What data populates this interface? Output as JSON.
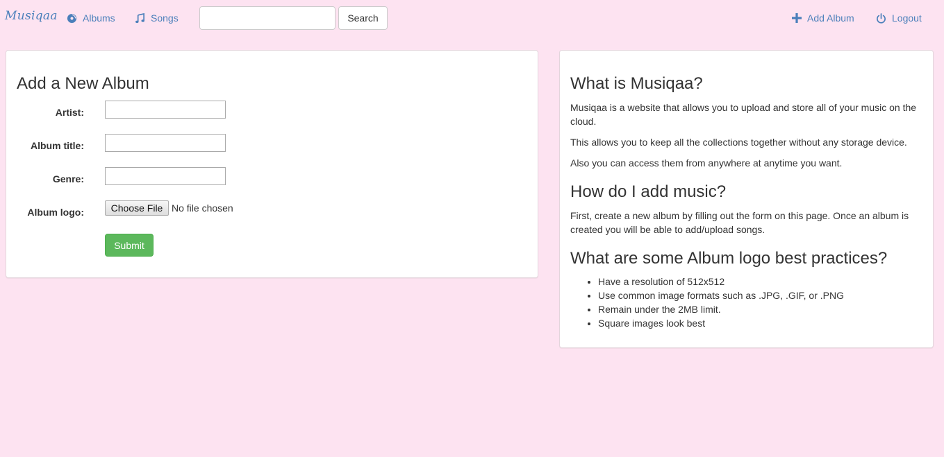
{
  "nav": {
    "brand": "Musiqaa",
    "albums_label": "Albums",
    "songs_label": "Songs",
    "search_placeholder": "",
    "search_button": "Search",
    "add_album_label": "Add Album",
    "logout_label": "Logout"
  },
  "form": {
    "title": "Add a New Album",
    "artist_label": "Artist:",
    "album_title_label": "Album title:",
    "genre_label": "Genre:",
    "logo_label": "Album logo:",
    "choose_file_label": "Choose File",
    "no_file_text": "No file chosen",
    "submit_label": "Submit"
  },
  "info": {
    "what_title": "What is Musiqaa?",
    "what_p1": "Musiqaa is a website that allows you to upload and store all of your music on the cloud.",
    "what_p2": "This allows you to keep all the collections together without any storage device.",
    "what_p3": "Also you can access them from anywhere at anytime you want.",
    "how_title": "How do I add music?",
    "how_p1": "First, create a new album by filling out the form on this page. Once an album is created you will be able to add/upload songs.",
    "tips_title": "What are some Album logo best practices?",
    "tips": [
      "Have a resolution of 512x512",
      "Use common image formats such as .JPG, .GIF, or .PNG",
      "Remain under the 2MB limit.",
      "Square images look best"
    ]
  },
  "colors": {
    "background": "#fde3f1",
    "link": "#4a7fba",
    "submit": "#5cb85c"
  }
}
